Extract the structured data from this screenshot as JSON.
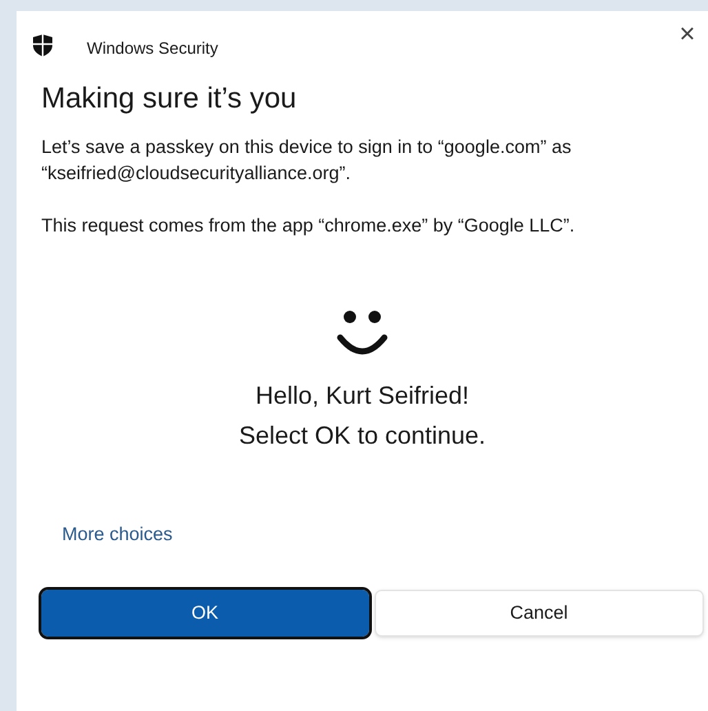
{
  "window": {
    "title": "Windows Security",
    "close": "×"
  },
  "heading": "Making sure it’s you",
  "paragraphs": [
    "Let’s save a passkey on this device to sign in to “google.com” as “kseifried@cloudsecurityalliance.org”.",
    "This request comes from the app “chrome.exe” by “Google LLC”."
  ],
  "greeting": [
    "Hello, Kurt Seifried!",
    "Select OK to continue."
  ],
  "more_choices": "More choices",
  "buttons": [
    {
      "label": "OK",
      "kind": "primary",
      "focused": true
    },
    {
      "label": "Cancel",
      "kind": "secondary",
      "focused": false
    }
  ]
}
